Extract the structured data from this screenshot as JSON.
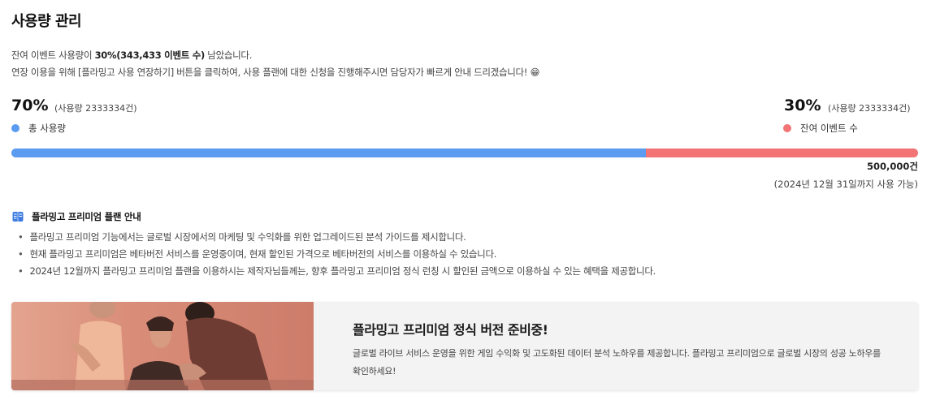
{
  "page_title": "사용량 관리",
  "description": {
    "line1_prefix": "잔여 이벤트 사용량이 ",
    "line1_bold": "30%(343,433 이벤트 수)",
    "line1_suffix": " 남았습니다.",
    "line2": "연장 이용을 위해 [플라밍고 사용 연장하기] 버튼을 클릭하여, 사용 플랜에 대한 신청을 진행해주시면 담당자가 빠르게 안내 드리겠습니다! 😁"
  },
  "usage": {
    "used": {
      "percent_label": "70%",
      "detail": "(사용량 2333334건)",
      "legend": "총 사용량",
      "fraction": 0.7,
      "color": "#5b9bf0"
    },
    "remaining": {
      "percent_label": "30%",
      "detail": "(사용량 2333334건)",
      "legend": "잔여 이벤트 수",
      "fraction": 0.3,
      "color": "#f27474"
    },
    "total": "500,000건",
    "deadline": "(2024년 12월 31일까지 사용 가능)"
  },
  "guide": {
    "title": "플라밍고 프리미엄 플랜 안내",
    "icon": "book-icon",
    "items": [
      "플라밍고 프리미엄 기능에서는 글로벌 시장에서의 마케팅 및 수익화를 위한 업그레이드된 분석 가이드를 제시합니다.",
      "현재 플라밍고 프리미엄은 베타버전 서비스를 운영중이며, 현재 할인된 가격으로 베타버전의 서비스를 이용하실 수 있습니다.",
      "2024년 12월까지 플라밍고 프리미엄 플랜을 이용하시는 제작자님들께는, 향후 플라밍고 프리미엄 정식 런칭 시 할인된 금액으로 이용하실 수 있는 혜택을 제공합니다."
    ]
  },
  "banner": {
    "title": "플라밍고 프리미엄 정식 버전 준비중!",
    "text": "글로벌 라이브 서비스 운영을 위한 게임 수익화 및 고도화된 데이터 분석 노하우를 제공합니다. 플라밍고 프리미엄으로 글로벌 시장의 성공 노하우를 확인하세요!"
  }
}
